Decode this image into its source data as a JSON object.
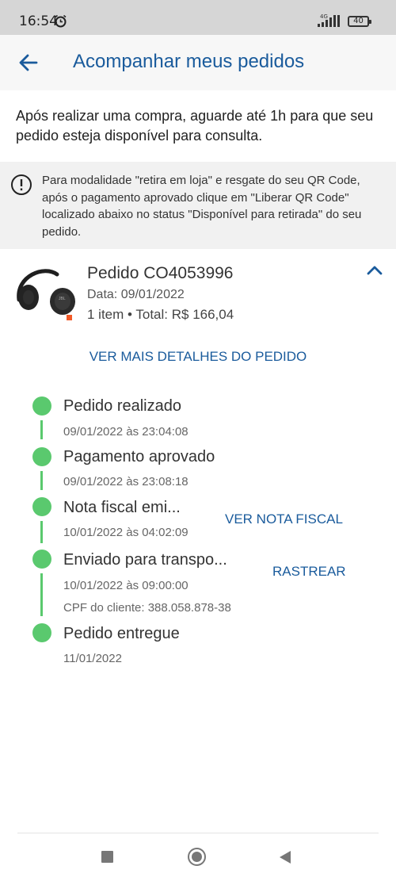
{
  "status_bar": {
    "time": "16:54",
    "network": "4G",
    "battery": "40"
  },
  "header": {
    "title": "Acompanhar meus pedidos",
    "back_icon": "arrow-left-icon"
  },
  "intro_text": "Após realizar uma compra, aguarde até 1h para que seu pedido esteja disponível para consulta.",
  "notice": {
    "icon": "info-exclamation-icon",
    "text": "Para modalidade \"retira em loja\" e resgate do seu QR Code, após o pagamento aprovado clique em \"Liberar QR Code\" localizado abaixo no status \"Disponível para retirada\" do seu pedido."
  },
  "order": {
    "title": "Pedido CO4053996",
    "date": "Data: 09/01/2022",
    "summary": "1 item • Total: R$ 166,04",
    "details_link": "VER MAIS DETALHES DO PEDIDO"
  },
  "timeline": [
    {
      "title": "Pedido realizado",
      "date": "09/01/2022 às 23:04:08"
    },
    {
      "title": "Pagamento aprovado",
      "date": "09/01/2022 às 23:08:18"
    },
    {
      "title": "Nota fiscal emi...",
      "date": "10/01/2022 às 04:02:09",
      "action": "VER NOTA FISCAL"
    },
    {
      "title": "Enviado para transpo...",
      "date": "10/01/2022 às 09:00:00",
      "extra": "CPF do cliente: 388.058.878-38",
      "action": "RASTREAR"
    },
    {
      "title": "Pedido entregue",
      "date": "11/01/2022"
    }
  ],
  "colors": {
    "accent": "#1a5b9c",
    "timeline_green": "#5ac96e",
    "notice_bg": "#f1f1f1"
  }
}
